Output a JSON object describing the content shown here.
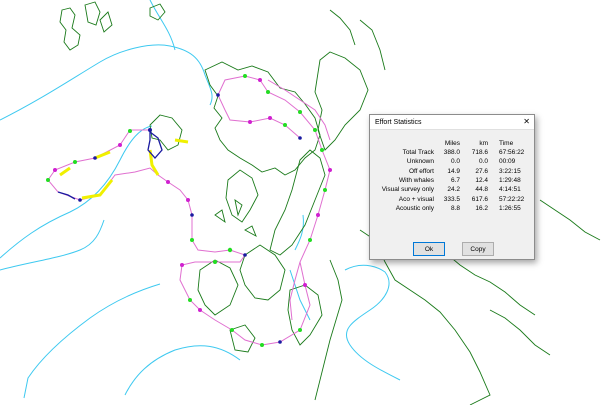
{
  "dialog": {
    "title": "Effort Statistics",
    "close_glyph": "✕",
    "headers": {
      "label": "",
      "miles": "Miles",
      "km": "km",
      "time": "Time"
    },
    "rows": [
      {
        "label": "Total Track",
        "miles": "388.0",
        "km": "718.6",
        "time": "67:56:22"
      },
      {
        "label": "Unknown",
        "miles": "0.0",
        "km": "0.0",
        "time": "00:09"
      },
      {
        "label": "Off effort",
        "miles": "14.9",
        "km": "27.6",
        "time": "3:22:15"
      },
      {
        "label": "With whales",
        "miles": "6.7",
        "km": "12.4",
        "time": "1:29:48"
      },
      {
        "label": "Visual survey only",
        "miles": "24.2",
        "km": "44.8",
        "time": "4:14:51"
      },
      {
        "label": "Aco + visual",
        "miles": "333.5",
        "km": "617.6",
        "time": "57:22:22"
      },
      {
        "label": "Acoustic only",
        "miles": "8.8",
        "km": "16.2",
        "time": "1:26:55"
      }
    ],
    "ok_label": "Ok",
    "copy_label": "Copy"
  },
  "map": {
    "coast_color": "#1a7a1a",
    "depth_contour_color": "#3ec9f0",
    "track_color": "#e070d0",
    "visual_only_color": "#f0f000",
    "acoustic_color": "#1a1aa0",
    "whale_marker_color": "#d020d0",
    "effort_marker_color": "#22dd22"
  }
}
